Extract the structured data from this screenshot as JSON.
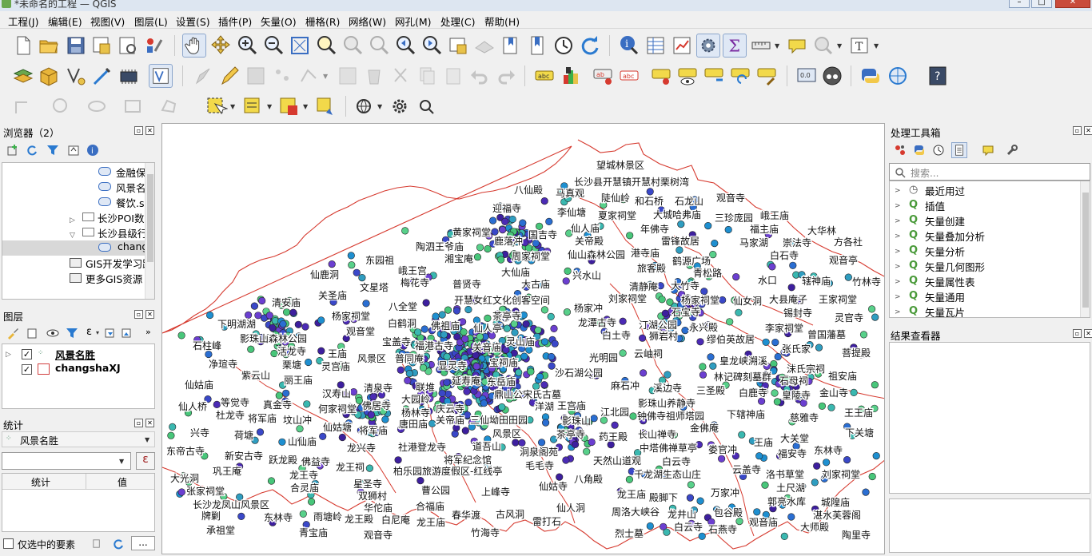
{
  "window": {
    "title": "*未命名的工程 — QGIS"
  },
  "menu": [
    "工程(J)",
    "编辑(E)",
    "视图(V)",
    "图层(L)",
    "设置(S)",
    "插件(P)",
    "矢量(O)",
    "栅格(R)",
    "网络(W)",
    "网孔(M)",
    "处理(C)",
    "帮助(H)"
  ],
  "browser": {
    "title": "浏览器（2）",
    "items": [
      "金融保",
      "风景名",
      "餐饮.s",
      "长沙POI数",
      "长沙县级行",
      "chang",
      "GIS开发学习路",
      "更多GIS资源",
      "..."
    ]
  },
  "layers": {
    "title": "图层",
    "items": [
      {
        "name": "风景名胜",
        "checked": true,
        "color": "#4a8a66"
      },
      {
        "name": "changshaXJ",
        "checked": true,
        "color": "#d14040"
      }
    ]
  },
  "stats": {
    "title": "统计",
    "layer": "风景名胜",
    "expr_icon": "ε",
    "col_stat": "统计",
    "col_value": "值",
    "only_selected": "仅选中的要素",
    "more": "..."
  },
  "toolbox": {
    "title": "处理工具箱",
    "search_placeholder": "搜索...",
    "items": [
      "最近用过",
      "插值",
      "矢量创建",
      "矢量叠加分析",
      "矢量分析",
      "矢量几何图形",
      "矢量属性表",
      "矢量通用",
      "矢量瓦片"
    ]
  },
  "results": {
    "title": "结果查看器"
  },
  "colors": {
    "boundary": "#d63a2f",
    "dots": [
      "#3d1f9e",
      "#4b2bb5",
      "#2a6ed2",
      "#3ab8b0",
      "#48c67a",
      "#1e8fd0",
      "#6b3fd0",
      "#2f9dc0",
      "#58d08a",
      "#3a48c8"
    ]
  },
  "map_labels": [
    "大园岭",
    "合灵庙",
    "缪伯英故居",
    "长沙县开慧镇开慧村栗树湾",
    "三珍庞园",
    "合福庙",
    "开慧女红文化创客空间",
    "龙潭古寺",
    "影珠山森林公园",
    "麻石冲",
    "新安古寺",
    "承祖堂",
    "影珠山养静寺",
    "影珠山",
    "城隍庙",
    "柏乐园旅游度假区-红线亭",
    "文星塔",
    "杨家祠堂",
    "年佛寺",
    "洛书草堂",
    "仙鹿洞",
    "鹿落冲",
    "白鹤洞",
    "风景区",
    "社港登龙寺",
    "湛水芙蓉阁",
    "茶亭寺",
    "雷打石",
    "兴寺",
    "黄家祠堂",
    "和石桥",
    "鼎山公宋氏古墓",
    "周洛大峡谷",
    "下辖神庙",
    "福港古寺",
    "牌剿",
    "郭亮水库",
    "迎福寺",
    "仙姑塘",
    "唐田庙",
    "中塔佛禅草亭",
    "石柱峰",
    "大光洞",
    "辖神庙",
    "宝祠庙",
    "星圣寺",
    "洞泉阁苑",
    "殿脚下",
    "仙山森林公园",
    "龙兴寺",
    "大师殿",
    "狮岩村",
    "千龙湖生态山庄",
    "丽王庙",
    "长山禅寺",
    "将军庙",
    "茶亭寺",
    "王庙",
    "龙王庙",
    "关圣庙",
    "竹林寺",
    "八角殿",
    "汀湖公园",
    "栗塘",
    "天然山道观",
    "白云寺",
    "观音寺",
    "宝盖寺",
    "显灵寺",
    "何家祠堂",
    "华佗庙",
    "溪边寺",
    "仙人桥",
    "李仙塘",
    "皇龙峡溯溪",
    "佛祖庙",
    "下明湖湖",
    "山仙庙",
    "风景区",
    "荷塘",
    "江北园",
    "青宝庙",
    "龙井山",
    "紫云山",
    "张家祠堂",
    "关帝庙",
    "王宫庙",
    "巩王庵",
    "东园祖",
    "灵宫庙",
    "关帝殿",
    "石龙山",
    "八全堂",
    "观音庙",
    "烈士墓",
    "白石寺",
    "光明园",
    "望城林景区",
    "夏家祠堂",
    "春华渡",
    "东林寺",
    "汉寿山",
    "仙人洞",
    "白尼庵",
    "药王殿",
    "大城哈弗庙",
    "庆云寺",
    "慈雅寺",
    "青松路",
    "永兴殿",
    "崇法寺",
    "普贤寺",
    "清安庙",
    "龙王祠",
    "古风洞",
    "万家冲",
    "三圣殿",
    "刘家祠堂",
    "大古庙",
    "方各社",
    "雷锋故居",
    "旅客殿",
    "金山寺",
    "祖安庙",
    "兴水山",
    "锡封寺",
    "道吾山",
    "仙人亭",
    "水口",
    "菩提殿",
    "仙女洞",
    "长沙龙凤山风景区",
    "大竹寺",
    "关音庙",
    "净瑄寺",
    "灵山庙",
    "马真观",
    "跃龙殿",
    "石宝寺",
    "观音亭",
    "大华林",
    "东岳庙",
    "刘家祠堂",
    "洋湖",
    "下关塘",
    "白鹿寺",
    "金佛庵",
    "王庙",
    "仙姑寺",
    "大仙庙",
    "王王庙",
    "普同庵",
    "湘宝庵",
    "杨林寺",
    "沫氏宗祠",
    "梅花寺",
    "国吉寺",
    "上峰寺",
    "马家湖",
    "联堆",
    "沙石湖公园",
    "皇陵寺",
    "观音堂",
    "将军庙",
    "仙人庙",
    "东林寺",
    "张氏家",
    "清静庵",
    "杨家祠堂",
    "佛居寺",
    "曾国藩墓",
    "福安寺",
    "竹海寺",
    "白土寺",
    "杨家冲",
    "陶里寺",
    "曹公园",
    "陶泗王爷庙",
    "福主庙",
    "活龙寺",
    "八仙殿",
    "白云寺",
    "坟山冲",
    "港寺庙",
    "长沙生态动物园",
    "等觉寺",
    "石燕湖生态旅游区-雷潭路",
    "石燕寺",
    "东帝古寺",
    "林记碑刻墓群",
    "灵官寺",
    "真金寺",
    "大县庵子",
    "大关堂",
    "清泉寺",
    "王家祠堂",
    "毛毛寺",
    "包谷殿",
    "周家祠堂",
    "陈昌烈士故居",
    "娄官冲",
    "仙姑庙",
    "龙王殿",
    "云盖寺",
    "双狮村",
    "雨塘岭",
    "云岫祠",
    "佛益寺",
    "李家祠堂",
    "将军纪念馆",
    "陡仙岭",
    "仙鹤古楼祠",
    "鹤源广场",
    "将军纪念馆",
    "石母祠",
    "三仙坳田田园",
    "土尺湖",
    "龙王庙",
    "钟佛寺祖师塔园",
    "延寿庵",
    "峨王宫",
    "观音寺",
    "峨王庙",
    "何氏宗祠",
    "杜龙寺",
    "龙王寺"
  ]
}
